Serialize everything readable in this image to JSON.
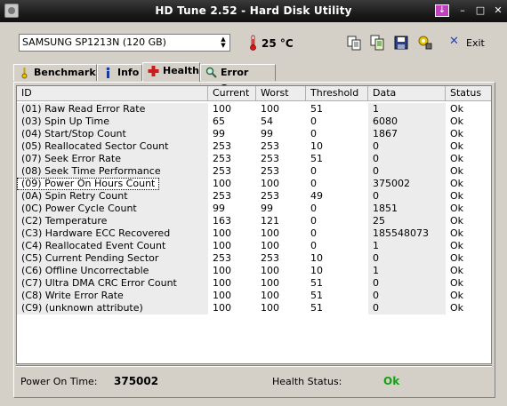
{
  "window": {
    "title": "HD Tune 2.52 - Hard Disk Utility"
  },
  "toolbar": {
    "drive": "SAMSUNG SP1213N (120 GB)",
    "temperature": "25 °C",
    "exit_label": "Exit"
  },
  "tabs": [
    {
      "label": "Benchmark",
      "icon": "benchmark-icon"
    },
    {
      "label": "Info",
      "icon": "info-icon"
    },
    {
      "label": "Health",
      "icon": "health-cross-icon"
    },
    {
      "label": "Error Scan",
      "icon": "magnifier-icon"
    }
  ],
  "table": {
    "headers": [
      "ID",
      "Current",
      "Worst",
      "Threshold",
      "Data",
      "Status"
    ],
    "rows": [
      [
        "(01) Raw Read Error Rate",
        "100",
        "100",
        "51",
        "1",
        "Ok"
      ],
      [
        "(03) Spin Up Time",
        "65",
        "54",
        "0",
        "6080",
        "Ok"
      ],
      [
        "(04) Start/Stop Count",
        "99",
        "99",
        "0",
        "1867",
        "Ok"
      ],
      [
        "(05) Reallocated Sector Count",
        "253",
        "253",
        "10",
        "0",
        "Ok"
      ],
      [
        "(07) Seek Error Rate",
        "253",
        "253",
        "51",
        "0",
        "Ok"
      ],
      [
        "(08) Seek Time Performance",
        "253",
        "253",
        "0",
        "0",
        "Ok"
      ],
      [
        "(09) Power On Hours Count",
        "100",
        "100",
        "0",
        "375002",
        "Ok"
      ],
      [
        "(0A) Spin Retry Count",
        "253",
        "253",
        "49",
        "0",
        "Ok"
      ],
      [
        "(0C) Power Cycle Count",
        "99",
        "99",
        "0",
        "1851",
        "Ok"
      ],
      [
        "(C2) Temperature",
        "163",
        "121",
        "0",
        "25",
        "Ok"
      ],
      [
        "(C3) Hardware ECC Recovered",
        "100",
        "100",
        "0",
        "185548073",
        "Ok"
      ],
      [
        "(C4) Reallocated Event Count",
        "100",
        "100",
        "0",
        "1",
        "Ok"
      ],
      [
        "(C5) Current Pending Sector",
        "253",
        "253",
        "10",
        "0",
        "Ok"
      ],
      [
        "(C6) Offline Uncorrectable",
        "100",
        "100",
        "10",
        "1",
        "Ok"
      ],
      [
        "(C7) Ultra DMA CRC Error Count",
        "100",
        "100",
        "51",
        "0",
        "Ok"
      ],
      [
        "(C8) Write Error Rate",
        "100",
        "100",
        "51",
        "0",
        "Ok"
      ],
      [
        "(C9) (unknown attribute)",
        "100",
        "100",
        "51",
        "0",
        "Ok"
      ]
    ],
    "selected_index": 6
  },
  "footer": {
    "power_on_label": "Power On Time:",
    "power_on_value": "375002",
    "health_label": "Health Status:",
    "health_value": "Ok"
  },
  "colors": {
    "health_ok": "#16a016",
    "exit_x": "#1a47c4",
    "temperature_icon": "#d01818"
  }
}
